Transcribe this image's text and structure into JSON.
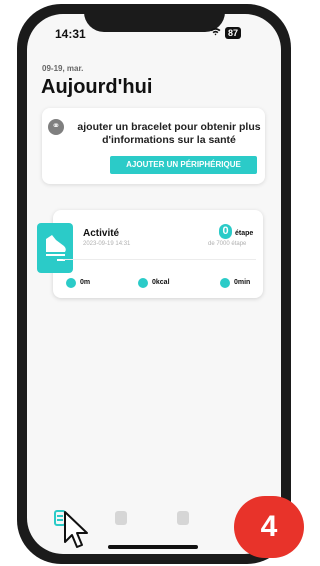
{
  "status_bar": {
    "time": "14:31",
    "wifi_icon": "wifi-icon",
    "battery": "87"
  },
  "header": {
    "date": "09-19, mar.",
    "title": "Aujourd'hui"
  },
  "promo_card": {
    "icon": "link-icon",
    "text": "ajouter un bracelet pour obtenir plus d'informations sur la santé",
    "button_label": "AJOUTER UN PÉRIPHÉRIQUE"
  },
  "activity_card": {
    "icon": "shoe-icon",
    "title": "Activité",
    "timestamp": "2023-09-19 14:31",
    "steps": "0",
    "steps_unit": "étape",
    "goal": "de 7000 étape",
    "metrics": [
      {
        "icon": "location-pin-icon",
        "value": "0m"
      },
      {
        "icon": "flame-icon",
        "value": "0kcal"
      },
      {
        "icon": "clock-icon",
        "value": "0min"
      }
    ]
  },
  "bottom_nav": {
    "items": [
      {
        "icon": "today-icon",
        "active": true
      },
      {
        "icon": "home-icon",
        "active": false
      },
      {
        "icon": "device-icon",
        "active": false
      }
    ]
  },
  "step_badge": "4",
  "accent_color": "#2bcbc8",
  "badge_color": "#e8332a"
}
